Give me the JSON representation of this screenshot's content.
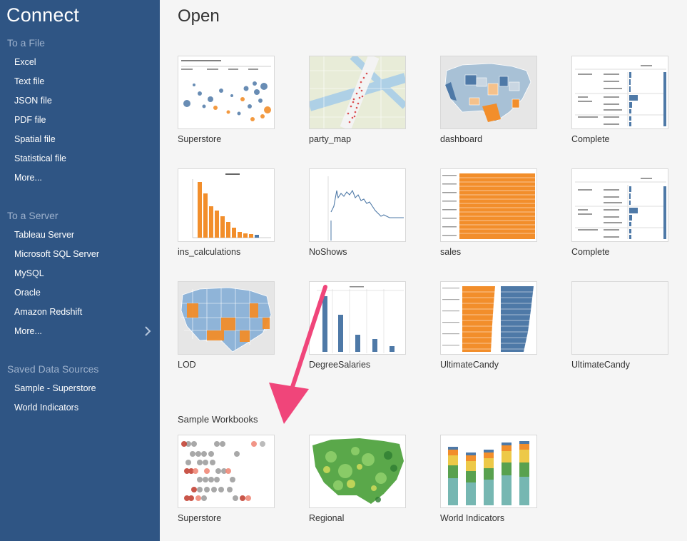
{
  "sidebar": {
    "title": "Connect",
    "to_file": {
      "heading": "To a File",
      "items": [
        "Excel",
        "Text file",
        "JSON file",
        "PDF file",
        "Spatial file",
        "Statistical file",
        "More..."
      ]
    },
    "to_server": {
      "heading": "To a Server",
      "items": [
        "Tableau Server",
        "Microsoft SQL Server",
        "MySQL",
        "Oracle",
        "Amazon Redshift",
        "More..."
      ]
    },
    "saved": {
      "heading": "Saved Data Sources",
      "items": [
        "Sample - Superstore",
        "World Indicators"
      ]
    }
  },
  "main": {
    "title": "Open",
    "workbooks": [
      {
        "label": "Superstore",
        "thumb": "map-circles"
      },
      {
        "label": "party_map",
        "thumb": "city-map"
      },
      {
        "label": "dashboard",
        "thumb": "choropleth"
      },
      {
        "label": "Complete",
        "thumb": "crosstab"
      },
      {
        "label": "ins_calculations",
        "thumb": "orange-bars"
      },
      {
        "label": "NoShows",
        "thumb": "line-chart"
      },
      {
        "label": "sales",
        "thumb": "orange-hbars"
      },
      {
        "label": "Complete",
        "thumb": "crosstab"
      },
      {
        "label": "LOD",
        "thumb": "lod-map"
      },
      {
        "label": "DegreeSalaries",
        "thumb": "blue-bars"
      },
      {
        "label": "UltimateCandy",
        "thumb": "dual-hbars"
      },
      {
        "label": "UltimateCandy",
        "thumb": "blank"
      }
    ],
    "sample_heading": "Sample Workbooks",
    "samples": [
      {
        "label": "Superstore",
        "thumb": "dot-strips"
      },
      {
        "label": "Regional",
        "thumb": "green-map"
      },
      {
        "label": "World Indicators",
        "thumb": "stacked-bars"
      }
    ]
  },
  "colors": {
    "sidebar_bg": "#2f5584",
    "accent_arrow": "#f0457a",
    "tableau_blue": "#4e79a7",
    "tableau_orange": "#f28e2b"
  },
  "icons": [
    "chevron-right-icon"
  ]
}
